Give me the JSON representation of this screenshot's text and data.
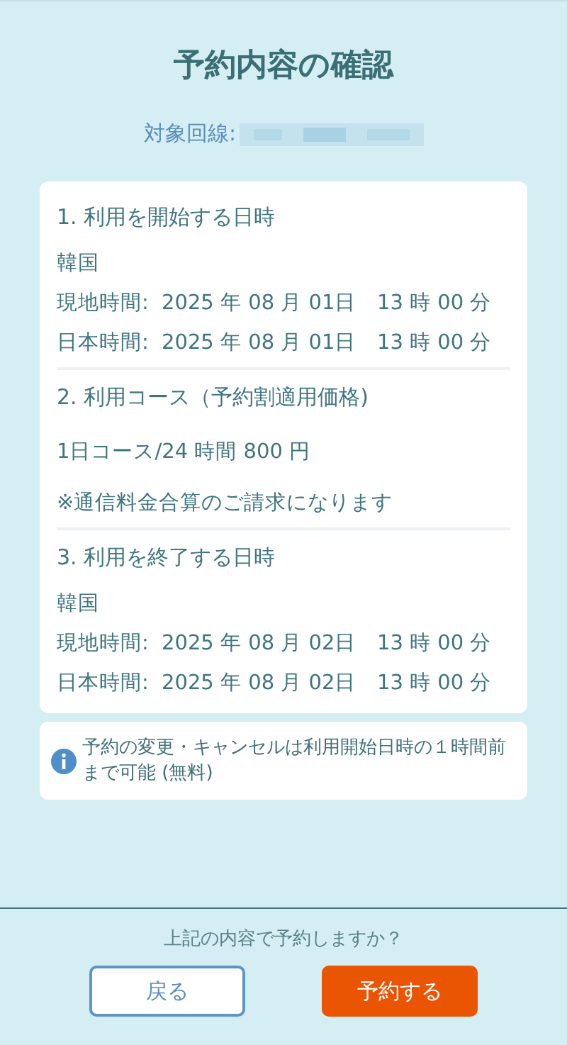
{
  "title": "予約内容の確認",
  "line_label": "対象回線:",
  "sections": [
    {
      "kind": "schedule",
      "heading": "1. 利用を開始する日時",
      "region": "韓国",
      "times": [
        {
          "label": "現地時間:",
          "date": "2025 年 08 月 01日",
          "time": "13 時 00 分"
        },
        {
          "label": "日本時間:",
          "date": "2025 年 08 月 01日",
          "time": "13 時 00 分"
        }
      ]
    },
    {
      "kind": "course",
      "heading": "2. 利用コース（予約割適用価格)",
      "plan": "1日コース/24 時間  800 円",
      "note": "※通信料金合算のご請求になります"
    },
    {
      "kind": "schedule",
      "heading": "3. 利用を終了する日時",
      "region": "韓国",
      "times": [
        {
          "label": "現地時間:",
          "date": "2025 年 08 月 02日",
          "time": "13 時 00 分"
        },
        {
          "label": "日本時間:",
          "date": "2025 年 08 月 02日",
          "time": "13 時 00 分"
        }
      ]
    }
  ],
  "notice": "予約の変更・キャンセルは利用開始日時の１時間前まで可能 (無料)",
  "question": "上記の内容で予約しますか？",
  "buttons": [
    {
      "kind": "secondary",
      "label": "戻る"
    },
    {
      "kind": "primary",
      "label": "予約する"
    }
  ]
}
